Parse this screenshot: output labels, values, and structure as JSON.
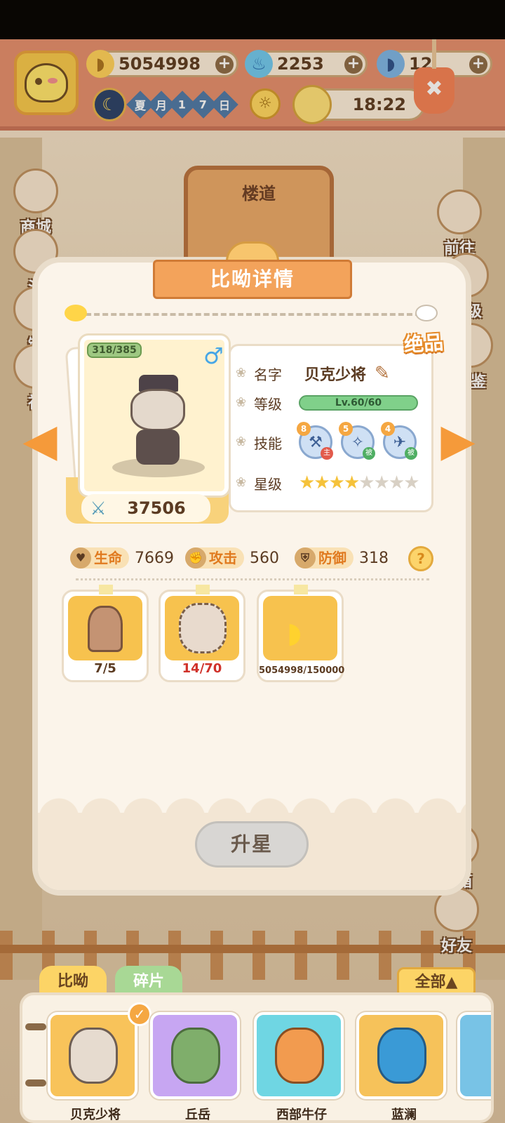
{
  "hud": {
    "gold": "5054998",
    "gems": "2253",
    "fish": "12",
    "date_chars": [
      "夏",
      "月",
      "1",
      "7",
      "日"
    ],
    "time": "18:22"
  },
  "scene": {
    "corridor_label": "楼道"
  },
  "side_left": [
    {
      "label": "商城"
    },
    {
      "label": "活"
    },
    {
      "label": "链"
    },
    {
      "label": "社"
    }
  ],
  "side_right": [
    {
      "label": "前往"
    },
    {
      "label": "等级"
    },
    {
      "label": "图鉴"
    },
    {
      "label": "邮箱"
    },
    {
      "label": "好友"
    }
  ],
  "dialog": {
    "title": "比呦详情",
    "hp_badge": "318/385",
    "gender": "♂",
    "rarity": "绝品",
    "power": "37506",
    "name_label": "名字",
    "name_value": "贝克少将",
    "level_label": "等级",
    "level_value": "Lv.60/60",
    "level_progress": 1.0,
    "skill_label": "技能",
    "skills": [
      {
        "level": "8",
        "tag": "主",
        "icon": "wrench-icon"
      },
      {
        "level": "5",
        "tag": "被",
        "icon": "compass-icon"
      },
      {
        "level": "4",
        "tag": "被",
        "icon": "plane-icon"
      }
    ],
    "star_label": "星级",
    "stars_filled": 4,
    "stars_total": 8,
    "stats": {
      "hp_label": "生命",
      "hp": "7669",
      "atk_label": "攻击",
      "atk": "560",
      "def_label": "防御",
      "def": "318",
      "help": "?"
    },
    "materials": [
      {
        "count": "7/5",
        "kind": "statue"
      },
      {
        "count": "14/70",
        "kind": "fragment"
      },
      {
        "count": "5054998/150000",
        "kind": "banana"
      }
    ],
    "upgrade_label": "升星"
  },
  "tabs": {
    "pets": "比呦",
    "fragments": "碎片",
    "filter": "全部▲"
  },
  "roster": [
    {
      "name": "贝克少将",
      "selected": true
    },
    {
      "name": "丘岳"
    },
    {
      "name": "西部牛仔"
    },
    {
      "name": "蓝澜"
    }
  ],
  "colors": {
    "accent": "#f3a35b",
    "gold": "#f5c23a",
    "text": "#5b3b22",
    "warning": "#d0322a"
  }
}
